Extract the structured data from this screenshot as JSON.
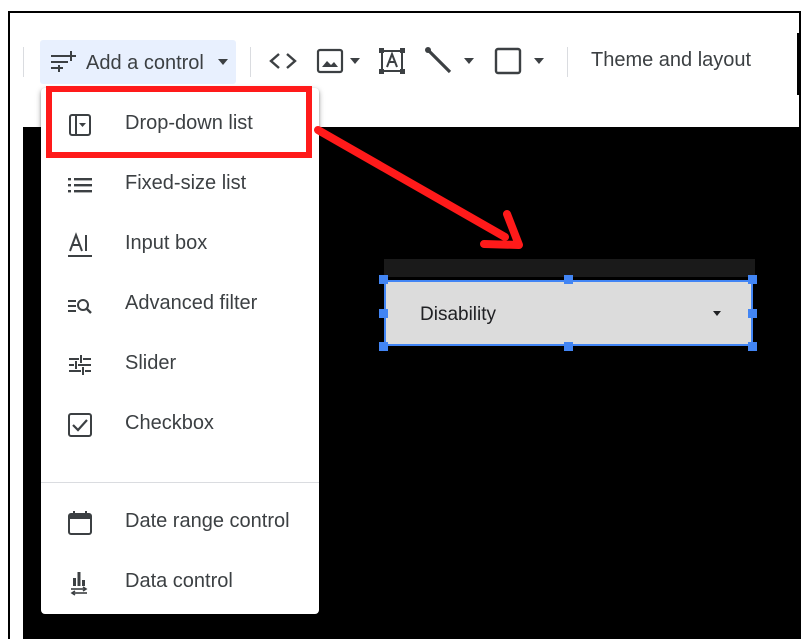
{
  "toolbar": {
    "add_control_label": "Add a control",
    "theme_label": "Theme and layout"
  },
  "menu": {
    "items": [
      {
        "label": "Drop-down list",
        "icon": "dropdown-list-icon"
      },
      {
        "label": "Fixed-size list",
        "icon": "list-icon"
      },
      {
        "label": "Input box",
        "icon": "input-box-icon"
      },
      {
        "label": "Advanced filter",
        "icon": "advanced-filter-icon"
      },
      {
        "label": "Slider",
        "icon": "slider-icon"
      },
      {
        "label": "Checkbox",
        "icon": "checkbox-icon"
      },
      {
        "label": "Date range control",
        "icon": "calendar-icon"
      },
      {
        "label": "Data control",
        "icon": "data-control-icon"
      }
    ]
  },
  "widget": {
    "value": "Disability"
  },
  "colors": {
    "accent": "#4285f4",
    "highlight": "#ff1a1a",
    "canvas": "#000000",
    "selected_bg": "#e8f0fe"
  }
}
